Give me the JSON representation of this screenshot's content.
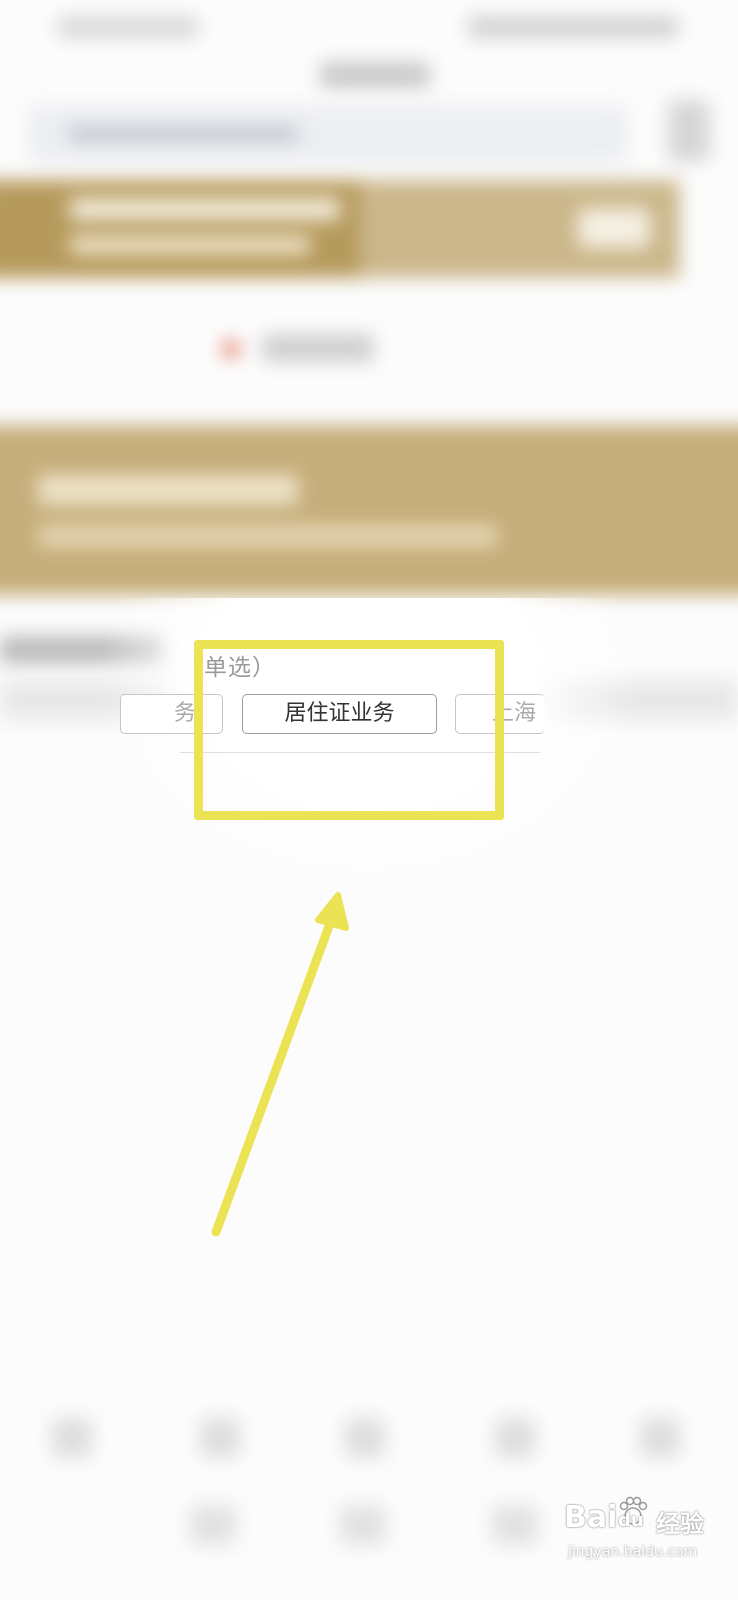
{
  "question": {
    "hint": "（单选）"
  },
  "options": {
    "left_partial": "务",
    "selected": "居住证业务",
    "right_partial": "上海"
  },
  "annotation": {
    "highlight_color": "#ece354",
    "arrow_color": "#ece354"
  },
  "watermark": {
    "brand": "Bai",
    "brand_du": "du",
    "product": "经验",
    "url": "jingyan.baidu.com"
  },
  "colors": {
    "gold_dark": "#b69a5c",
    "gold_light": "#c6ae7b"
  }
}
